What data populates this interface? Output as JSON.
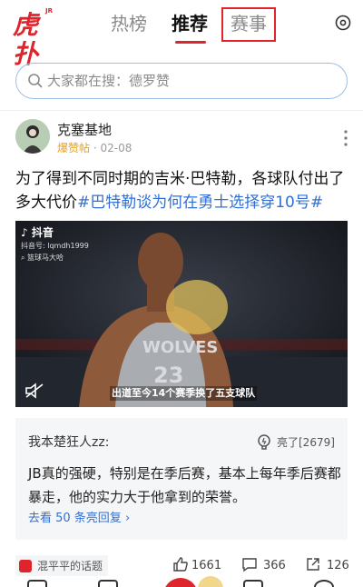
{
  "header": {
    "logo_main": "虎扑",
    "logo_tag": "JR",
    "tabs": [
      {
        "label": "热榜"
      },
      {
        "label": "推荐"
      },
      {
        "label": "赛事"
      }
    ]
  },
  "search": {
    "placeholder": "大家都在搜：德罗赞"
  },
  "post": {
    "author": "克塞基地",
    "source": "爆赞帖",
    "date": "02-08",
    "text": "为了得到不同时期的吉米·巴特勒，各球队付出了多大代价",
    "topic": "#巴特勒谈为何在勇士选择穿10号#"
  },
  "video": {
    "app": "抖音",
    "id_label": "抖音号: lqmdh1999",
    "channel": "篮球马大哈",
    "caption": "出道至今14个赛季换了五支球队"
  },
  "comment": {
    "user": "我本楚狂人zz:",
    "likes": "亮了[2679]",
    "text": "JB真的强硬，特别是在季后赛，基本上每年季后赛都暴走，他的实力大于他拿到的荣誉。",
    "reply_link": "去看 50 条亮回复"
  },
  "footer": {
    "topic": "混平平的话题",
    "likes": "1661",
    "comments": "366",
    "shares": "126"
  },
  "colors": {
    "brand_red": "#e0242b",
    "link_blue": "#2f6fd6",
    "source_orange": "#e8a11a"
  }
}
